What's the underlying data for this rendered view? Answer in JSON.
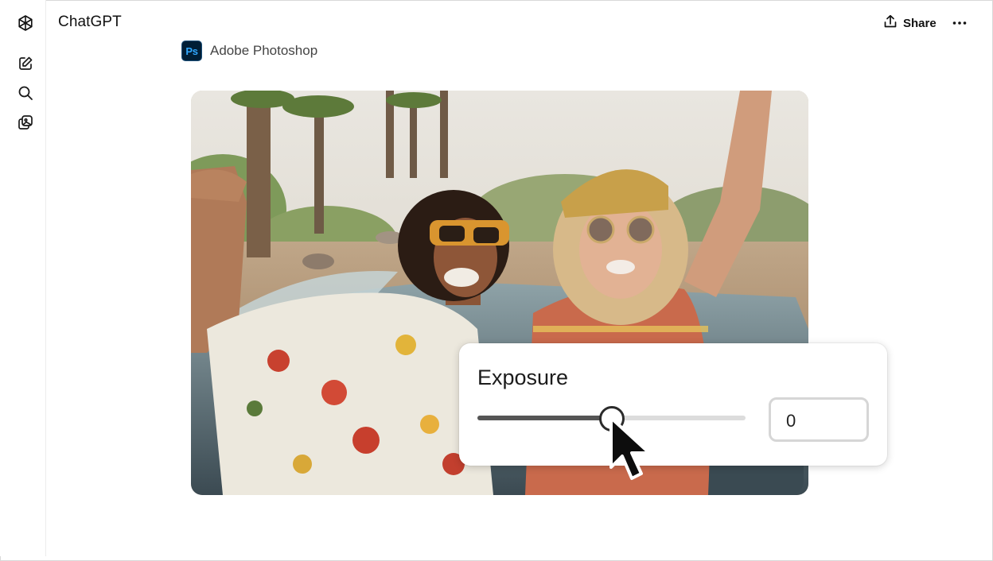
{
  "header": {
    "title": "ChatGPT",
    "share_label": "Share"
  },
  "sidebar": {
    "items": [
      {
        "icon": "openai-logo-icon"
      },
      {
        "icon": "new-chat-icon"
      },
      {
        "icon": "search-icon"
      },
      {
        "icon": "library-icon"
      }
    ]
  },
  "app": {
    "logo_text": "Ps",
    "name": "Adobe Photoshop"
  },
  "exposure": {
    "label": "Exposure",
    "value": "0",
    "slider_fraction": 0.5
  },
  "colors": {
    "ps_bg": "#001e36",
    "ps_accent": "#31a8ff",
    "slider_fill": "#555555",
    "slider_track": "#dcdcdc"
  }
}
